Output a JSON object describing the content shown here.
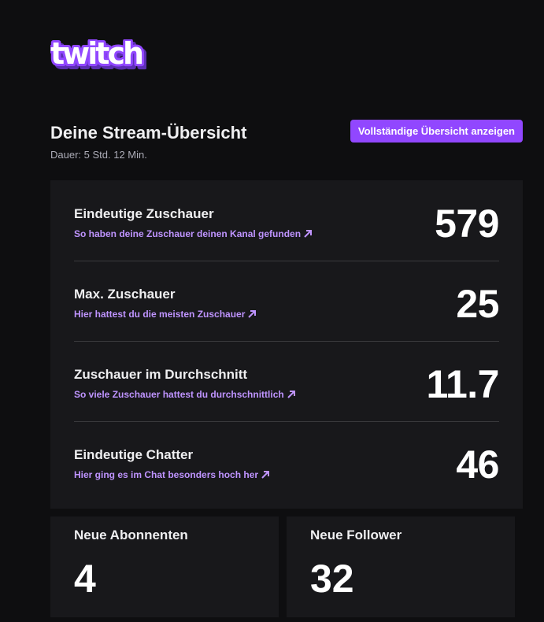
{
  "brand": {
    "logo_text": "twitch",
    "accent_color": "#9147ff",
    "link_color": "#bf94ff"
  },
  "header": {
    "title": "Deine Stream-Übersicht",
    "duration": "Dauer: 5 Std. 12 Min.",
    "full_overview_label": "Vollständige Übersicht anzeigen"
  },
  "stats": [
    {
      "label": "Eindeutige Zuschauer",
      "link": "So haben deine Zuschauer deinen Kanal gefunden",
      "value": "579",
      "icon": "arrow-up-right-icon"
    },
    {
      "label": "Max. Zuschauer",
      "link": "Hier hattest du die meisten Zuschauer",
      "value": "25",
      "icon": "arrow-up-right-icon"
    },
    {
      "label": "Zuschauer im Durchschnitt",
      "link": "So viele Zuschauer hattest du durchschnittlich",
      "value": "11.7",
      "icon": "arrow-up-right-icon"
    },
    {
      "label": "Eindeutige Chatter",
      "link": "Hier ging es im Chat besonders hoch her",
      "value": "46",
      "icon": "arrow-up-right-icon"
    }
  ],
  "subscribers": {
    "label": "Neue Abonnenten",
    "value": "4"
  },
  "followers": {
    "label": "Neue Follower",
    "value": "32"
  }
}
